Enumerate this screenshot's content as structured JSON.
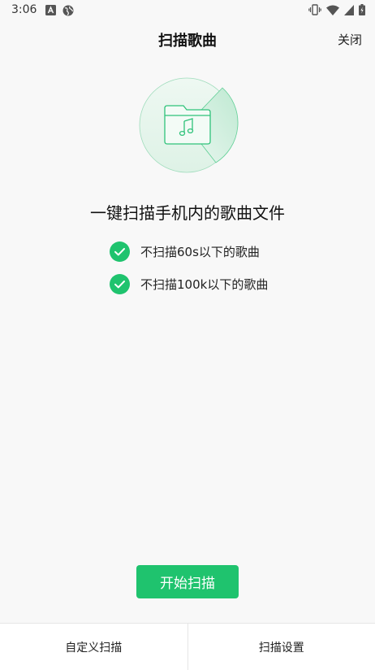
{
  "status_bar": {
    "time": "3:06"
  },
  "header": {
    "title": "扫描歌曲",
    "close_label": "关闭"
  },
  "main": {
    "headline": "一键扫描手机内的歌曲文件",
    "criteria": [
      "不扫描60s以下的歌曲",
      "不扫描100k以下的歌曲"
    ],
    "start_button_label": "开始扫描"
  },
  "bottom_bar": {
    "custom_scan_label": "自定义扫描",
    "scan_settings_label": "扫描设置"
  },
  "colors": {
    "accent": "#1fc36e",
    "background": "#f8f8f8"
  }
}
